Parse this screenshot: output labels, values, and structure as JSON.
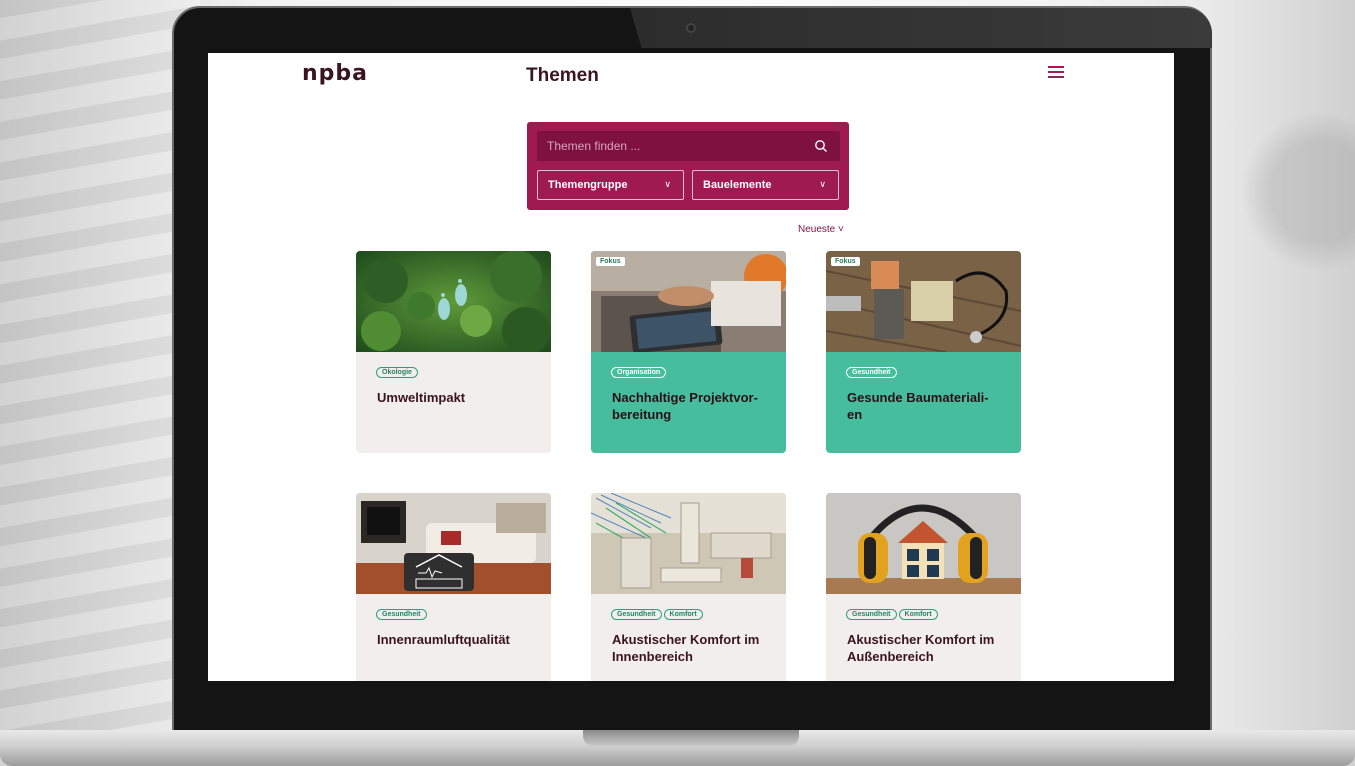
{
  "site": {
    "logo": "npba",
    "title": "Themen"
  },
  "search": {
    "placeholder": "Themen finden ...",
    "dropdowns": [
      {
        "label": "Themengruppe"
      },
      {
        "label": "Bauelemente"
      }
    ]
  },
  "sort": {
    "label": "Neueste ˅"
  },
  "cards": [
    {
      "title": "Umweltimpakt",
      "tags": [
        "Ökologie"
      ],
      "fokus": "",
      "image": "forest-footprint-photo"
    },
    {
      "title": "Nachhaltige Projektvor-bereitung",
      "title_line1": "Nachhaltige Projektvor-",
      "title_line2": "bereitung",
      "tags": [
        "Organisation"
      ],
      "fokus": "Fokus",
      "image": "planning-tablet-photo"
    },
    {
      "title": "Gesunde Baumateriali-en",
      "title_line1": "Gesunde Baumateriali-",
      "title_line2": "en",
      "tags": [
        "Gesundheit"
      ],
      "fokus": "Fokus",
      "image": "materials-stethoscope-photo"
    },
    {
      "title": "Innenraumluftqualität",
      "tags": [
        "Gesundheit"
      ],
      "fokus": "",
      "image": "living-room-breathe-photo"
    },
    {
      "title_line1": "Akustischer Komfort im",
      "title_line2": "Innenbereich",
      "tags": [
        "Gesundheit",
        "Komfort"
      ],
      "fokus": "",
      "image": "acoustic-simulation-render"
    },
    {
      "title_line1": "Akustischer Komfort im",
      "title_line2": "Außenbereich",
      "tags": [
        "Gesundheit",
        "Komfort"
      ],
      "fokus": "",
      "image": "house-earmuffs-photo"
    }
  ],
  "colors": {
    "brand": "#9e1a51",
    "brand_dark": "#7f1140",
    "card_green": "#46be9d",
    "card_light": "#f3eeee",
    "title_text": "#3a1420"
  }
}
